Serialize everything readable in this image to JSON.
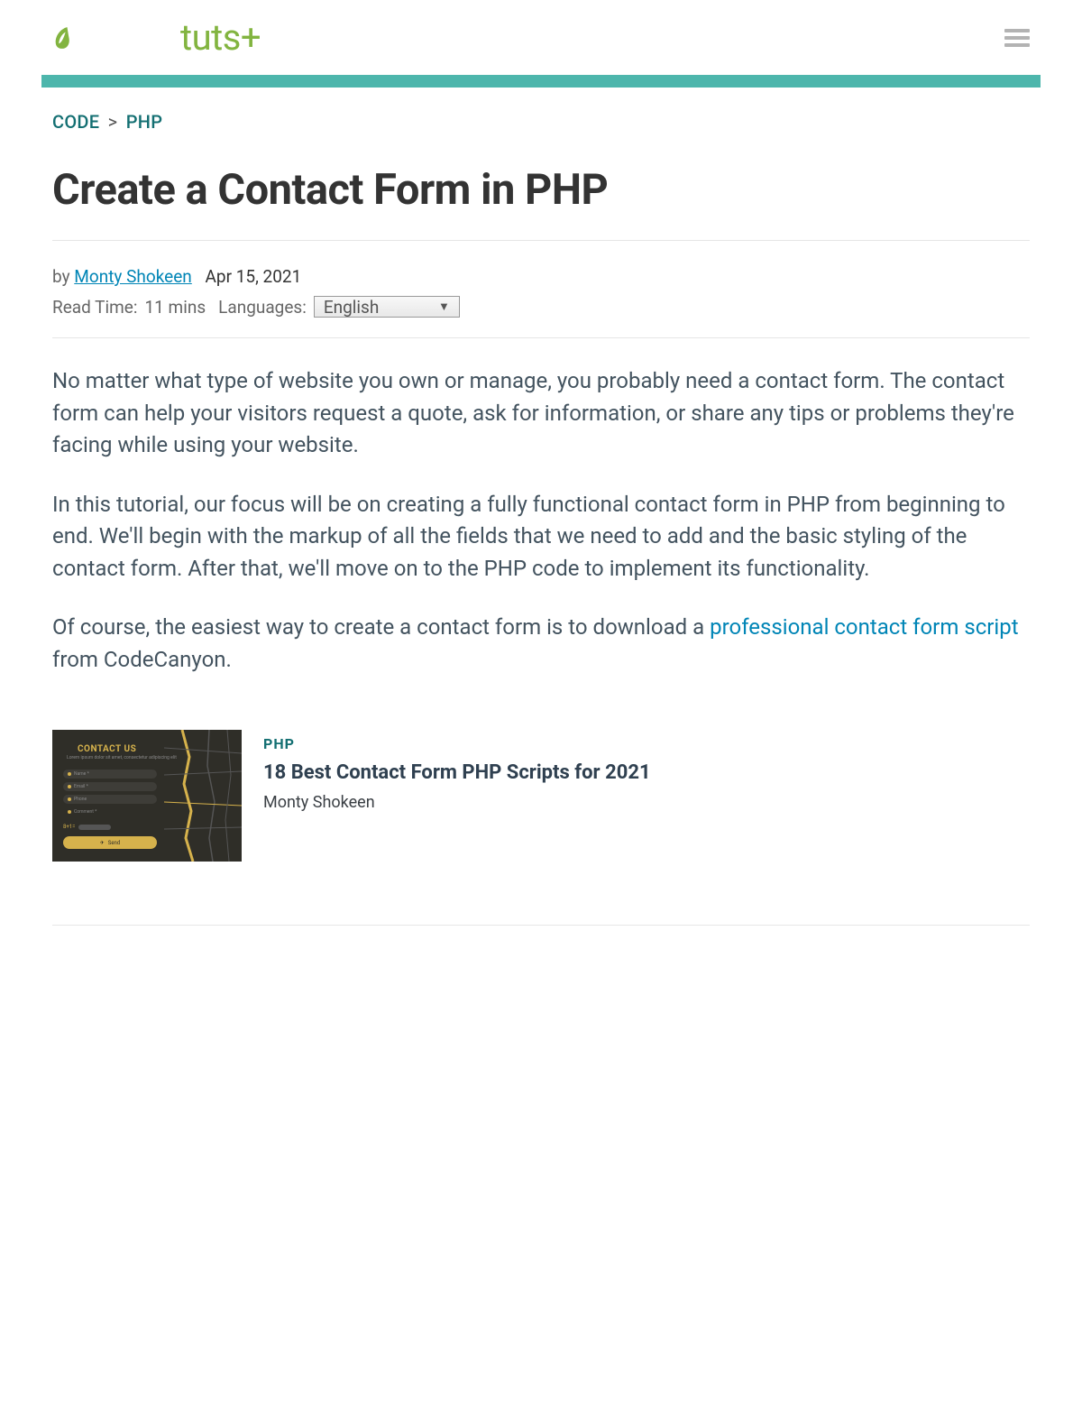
{
  "header": {
    "logo_text": "tuts+"
  },
  "breadcrumb": {
    "cat1": "CODE",
    "sep": ">",
    "cat2": "PHP"
  },
  "article": {
    "title": "Create a Contact Form in PHP",
    "by_label": "by",
    "author": "Monty Shokeen",
    "date": "Apr 15, 2021",
    "read_time_label": "Read Time:",
    "read_time_value": "11 mins",
    "languages_label": "Languages:",
    "selected_language": "English"
  },
  "paragraphs": {
    "p1": "No matter what type of website you own or manage, you probably need a contact form. The contact form can help your visitors request a quote, ask for information, or share any tips or problems they're facing while using your website.",
    "p2": "In this tutorial, our focus will be on creating a fully functional contact form in PHP from beginning to end. We'll begin with the markup of all the fields that we need to add and the basic styling of the contact form. After that, we'll move on to the PHP code to implement its functionality.",
    "p3_pre": "Of course, the easiest way to create a contact form is to download a ",
    "p3_link": "professional contact form script",
    "p3_post": " from CodeCanyon."
  },
  "related": {
    "category": "PHP",
    "title": "18 Best Contact Form PHP Scripts for 2021",
    "author": "Monty Shokeen"
  },
  "thumb": {
    "title": "CONTACT US",
    "subtitle": "Lorem ipsum dolor sit amet, consectetur adipiscing elit",
    "fields": [
      "Name *",
      "Email *",
      "Phone",
      "Comment *"
    ],
    "captcha": "8+1=",
    "send": "Send"
  }
}
